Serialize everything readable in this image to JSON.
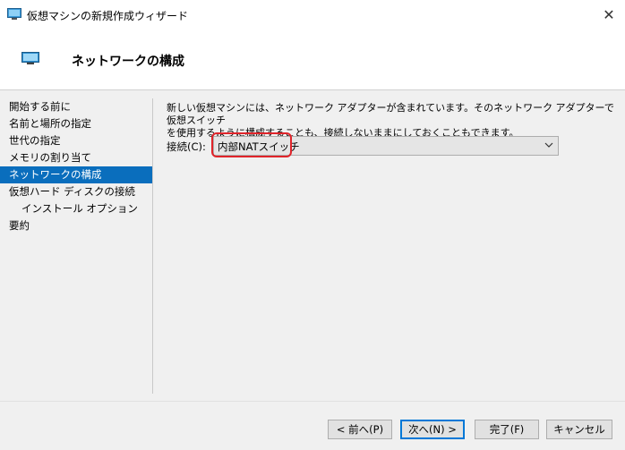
{
  "window": {
    "title": "仮想マシンの新規作成ウィザード",
    "close_glyph": "✕"
  },
  "header": {
    "title": "ネットワークの構成"
  },
  "nav": {
    "items": [
      {
        "label": "開始する前に"
      },
      {
        "label": "名前と場所の指定"
      },
      {
        "label": "世代の指定"
      },
      {
        "label": "メモリの割り当て"
      },
      {
        "label": "ネットワークの構成"
      },
      {
        "label": "仮想ハード ディスクの接続"
      },
      {
        "label": "インストール オプション"
      },
      {
        "label": "要約"
      }
    ],
    "active_index": 4
  },
  "content": {
    "description_line1": "新しい仮想マシンには、ネットワーク アダプターが含まれています。そのネットワーク アダプターで仮想スイッチ",
    "description_line2": "を使用するように構成することも、接続しないままにしておくこともできます。",
    "connection_label": "接続(C):",
    "connection_value": "内部NATスイッチ"
  },
  "buttons": {
    "previous": "< 前へ(P)",
    "next": "次へ(N) >",
    "finish": "完了(F)",
    "cancel": "キャンセル"
  },
  "colors": {
    "accent": "#0a6ebd",
    "highlight": "#e0242a"
  }
}
